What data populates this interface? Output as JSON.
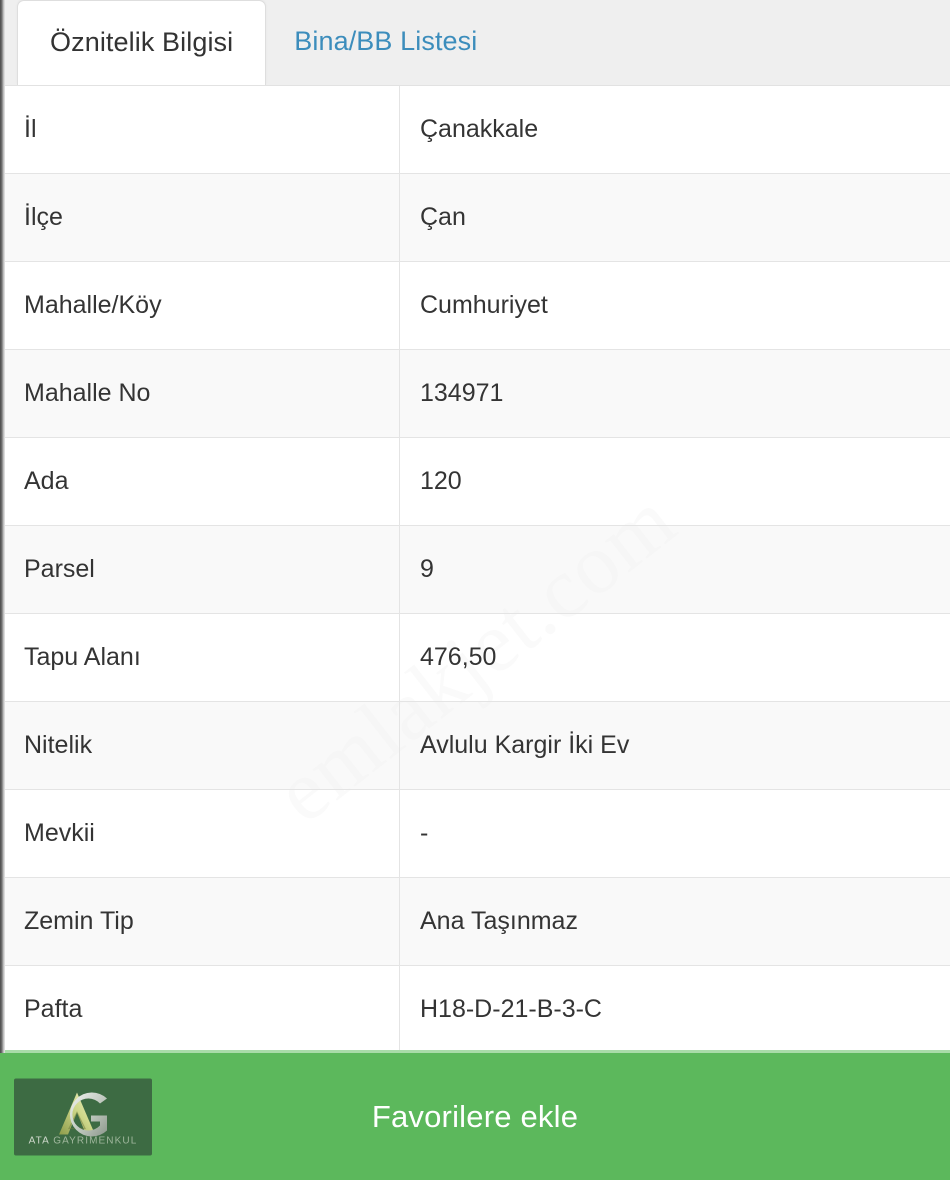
{
  "colors": {
    "accent_green": "#5cb85c",
    "accent_green_border": "#a9dca9",
    "tab_link_blue": "#3c8dbc",
    "text_dark": "#343434",
    "row_alt": "#f6f6f6",
    "tabbar_bg": "#efefef",
    "logo_bg": "#3d6b43"
  },
  "tabs": [
    {
      "label": "Öznitelik Bilgisi",
      "active": true
    },
    {
      "label": "Bina/BB Listesi",
      "active": false
    }
  ],
  "watermark": {
    "text": "emlakjet.com"
  },
  "table": {
    "rows": [
      {
        "label": "İl",
        "value": "Çanakkale"
      },
      {
        "label": "İlçe",
        "value": "Çan"
      },
      {
        "label": "Mahalle/Köy",
        "value": "Cumhuriyet"
      },
      {
        "label": "Mahalle No",
        "value": "134971"
      },
      {
        "label": "Ada",
        "value": "120"
      },
      {
        "label": "Parsel",
        "value": "9"
      },
      {
        "label": "Tapu Alanı",
        "value": "476,50"
      },
      {
        "label": "Nitelik",
        "value": "Avlulu Kargir İki Ev"
      },
      {
        "label": "Mevkii",
        "value": "-"
      },
      {
        "label": "Zemin Tip",
        "value": "Ana Taşınmaz"
      },
      {
        "label": "Pafta",
        "value": "H18-D-21-B-3-C"
      }
    ]
  },
  "footer": {
    "favorite_label": "Favorilere ekle",
    "logo": {
      "name_part1": "ATA",
      "name_part2": "GAYRİMENKUL",
      "monogram": "AG"
    }
  }
}
